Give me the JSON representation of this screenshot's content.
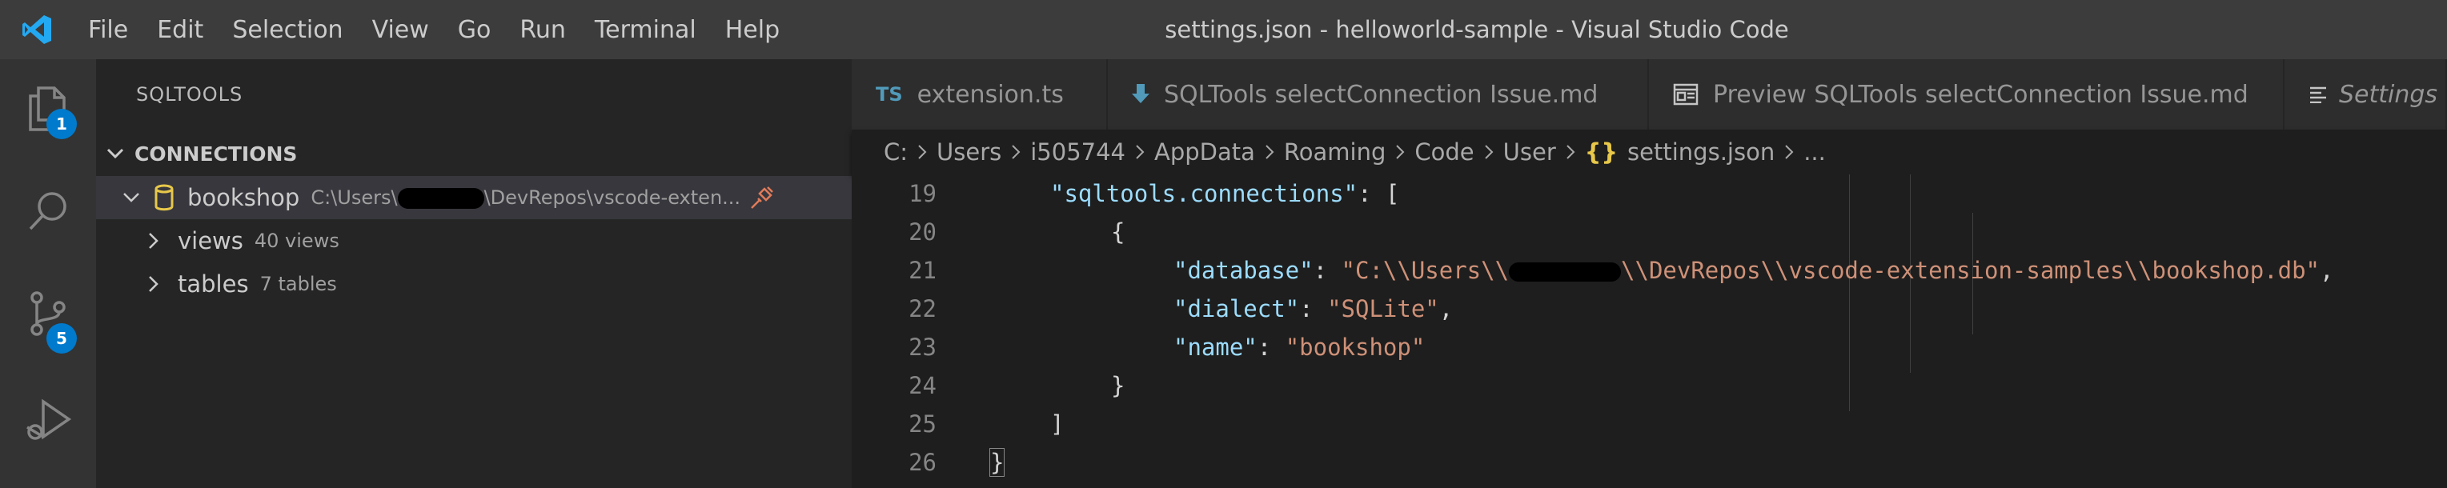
{
  "window": {
    "title": "settings.json - helloworld-sample - Visual Studio Code"
  },
  "menu": [
    "File",
    "Edit",
    "Selection",
    "View",
    "Go",
    "Run",
    "Terminal",
    "Help"
  ],
  "activity_bar": {
    "explorer_badge": "1",
    "source_control_badge": "5"
  },
  "sidebar": {
    "title": "SQLTOOLS",
    "section": "CONNECTIONS",
    "connection": {
      "label": "bookshop",
      "path_prefix": "C:\\Users\\",
      "path_suffix": "\\DevRepos\\vscode-exten..."
    },
    "children": [
      {
        "label": "views",
        "desc": "40 views"
      },
      {
        "label": "tables",
        "desc": "7 tables"
      }
    ]
  },
  "tabs": [
    {
      "icon": "TS",
      "label": "extension.ts"
    },
    {
      "label": "SQLTools selectConnection Issue.md"
    },
    {
      "label": "Preview SQLTools selectConnection Issue.md"
    },
    {
      "label": "Settings"
    }
  ],
  "breadcrumbs": [
    "C:",
    "Users",
    "i505744",
    "AppData",
    "Roaming",
    "Code",
    "User",
    "settings.json",
    "..."
  ],
  "code": {
    "line_numbers": [
      "19",
      "20",
      "21",
      "22",
      "23",
      "24",
      "25",
      "26"
    ],
    "l19_key": "\"sqltools.connections\"",
    "l19_rest": ": [",
    "l20": "{",
    "l21_key": "\"database\"",
    "l21_colon": ": ",
    "l21_val_a": "\"C:\\\\Users\\\\",
    "l21_val_b": "\\\\DevRepos\\\\vscode-extension-samples\\\\bookshop.db\"",
    "l21_comma": ",",
    "l22_key": "\"dialect\"",
    "l22_colon": ": ",
    "l22_val": "\"SQLite\"",
    "l22_comma": ",",
    "l23_key": "\"name\"",
    "l23_colon": ": ",
    "l23_val": "\"bookshop\"",
    "l24": "}",
    "l25": "]",
    "l26": "}"
  }
}
